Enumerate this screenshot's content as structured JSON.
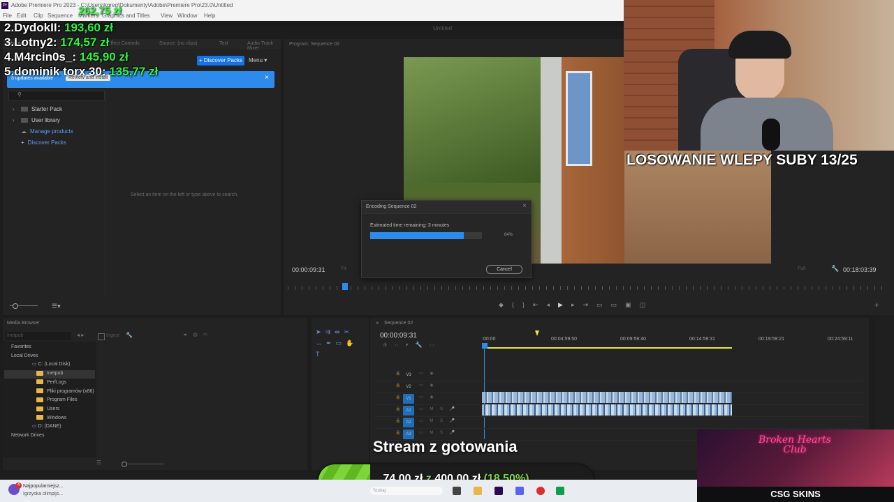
{
  "window": {
    "title": "Adobe Premiere Pro 2023 - C:\\Users\\kgreg\\Dokumenty\\Adobe\\Premiere Pro\\23.0\\Untitled",
    "program_title": "Untitled",
    "app_badge": "Pr"
  },
  "menu": [
    "File",
    "Edit",
    "Clip",
    "Sequence",
    "Markers",
    "Graphics and Titles",
    "View",
    "Window",
    "Help"
  ],
  "leaderboard": {
    "top_amount": "262,75 zł",
    "entries": [
      {
        "name": "2.DydokII:",
        "amount": "193,60 zł"
      },
      {
        "name": "3.Lotny2:",
        "amount": "174,57 zł"
      },
      {
        "name": "4.M4rcin0s_:",
        "amount": "145,90 zł"
      },
      {
        "name": "5.dominik torx 30:",
        "amount": "135,77 zł"
      }
    ]
  },
  "libraries_panel": {
    "tabs": [
      "Libraries",
      "Effect Controls",
      "Source: (no clips)",
      "Text",
      "Audio Track Mixer"
    ],
    "discover_packs_button": "+ Discover Packs",
    "menu_button": "Menu",
    "banner_text": "3 updates available",
    "banner_action": "Review and install",
    "tree": [
      {
        "label": "Starter Pack",
        "link": false
      },
      {
        "label": "User library",
        "link": false
      },
      {
        "label": "Manage products",
        "link": true
      },
      {
        "label": "Discover Packs",
        "link": true
      }
    ],
    "empty_hint": "Select an item on the left or type above to search."
  },
  "program_monitor": {
    "tab": "Program: Sequence 02",
    "timecode_left": "00:00:09:31",
    "timecode_right": "00:18:03:39",
    "fit": "Fit",
    "resolution": "Full"
  },
  "encoding_dialog": {
    "title": "Encoding Sequence 02",
    "estimate": "Estimated time remaining: 3 minutes",
    "progress": 0.84,
    "percent_label": "84%",
    "cancel_button": "Cancel"
  },
  "webcam": {
    "caption": "LOSOWANIE WLEPY SUBY 13/25"
  },
  "media_browser": {
    "tab": "Media Browser",
    "search_value": "Inetpub",
    "ingest_label": "Ingest",
    "items": [
      {
        "label": "Favorites",
        "level": 0,
        "folder": false
      },
      {
        "label": "Local Drives",
        "level": 0,
        "folder": false
      },
      {
        "label": "C: (Local Disk)",
        "level": 1,
        "folder": false
      },
      {
        "label": "Inetpub",
        "level": 2,
        "folder": true
      },
      {
        "label": "PerfLogs",
        "level": 2,
        "folder": true
      },
      {
        "label": "Pliki programów (x86)",
        "level": 2,
        "folder": true
      },
      {
        "label": "Program Files",
        "level": 2,
        "folder": true
      },
      {
        "label": "Users",
        "level": 2,
        "folder": true
      },
      {
        "label": "Windows",
        "level": 2,
        "folder": true
      },
      {
        "label": "D: (DANE)",
        "level": 1,
        "folder": false
      },
      {
        "label": "Network Drives",
        "level": 0,
        "folder": false
      }
    ]
  },
  "timeline": {
    "tab": "Sequence 02",
    "timecode": "00:00:09:31",
    "ruler": [
      ":00:00",
      "00:04:59:50",
      "00:09:59:40",
      "00:14:59:31",
      "00:19:59:21",
      "00:24:59:11"
    ],
    "tracks": [
      "V3",
      "V2",
      "V1",
      "A1",
      "A2",
      "A3"
    ]
  },
  "stream_overlay": {
    "title": "Stream z gotowania",
    "goal_current": "74,00 zł",
    "goal_word": "z",
    "goal_target": "400,00 zł",
    "goal_percent": "(18.50%)",
    "goal_fraction": 0.185
  },
  "sponsor": {
    "art_title": "Broken Hearts Club",
    "brand": "CSG SKINS"
  },
  "taskbar": {
    "notification_count": "4",
    "notif_title": "Najpopularniejsz...",
    "notif_sub": "Igrzyska olimpijs...",
    "search_placeholder": "Szukaj"
  },
  "colors": {
    "accent_blue": "#1473e6",
    "progress_blue": "#2d8ceb",
    "leader_green": "#2df542",
    "goal_green": "#7cd63a",
    "yellow_workarea": "#e8e84a"
  }
}
